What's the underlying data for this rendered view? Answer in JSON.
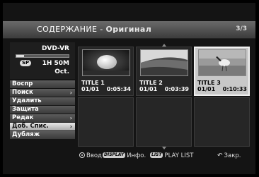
{
  "header": {
    "title": "СОДЕРЖАНИЕ - ",
    "subtitle": "Оригинал",
    "page": "3/3"
  },
  "disc": {
    "type": "DVD-VR",
    "badge": "SP",
    "remaining": "1H 50M",
    "mode": "Oct.",
    "usage_fraction": 0.15
  },
  "menu": {
    "items": [
      {
        "label": "Воспр",
        "arrow": ""
      },
      {
        "label": "Поиск",
        "arrow": "›"
      },
      {
        "label": "Удалить",
        "arrow": ""
      },
      {
        "label": "Защита",
        "arrow": ""
      },
      {
        "label": "Редак",
        "arrow": "›"
      },
      {
        "label": "Доб. Спис.",
        "arrow": "›"
      },
      {
        "label": "Дубляж",
        "arrow": ""
      }
    ]
  },
  "titles": [
    {
      "name": "TITLE 1",
      "date": "01/01",
      "duration": "0:05:34"
    },
    {
      "name": "TITLE 2",
      "date": "01/01",
      "duration": "0:03:39"
    },
    {
      "name": "TITLE 3",
      "date": "01/01",
      "duration": "0:10:33"
    }
  ],
  "footer": {
    "enter": "Ввод",
    "display_key": "DISPLAY",
    "info": "Инфо.",
    "list_key": "LIST",
    "playlist": "PLAY LIST",
    "close": "Закр."
  }
}
